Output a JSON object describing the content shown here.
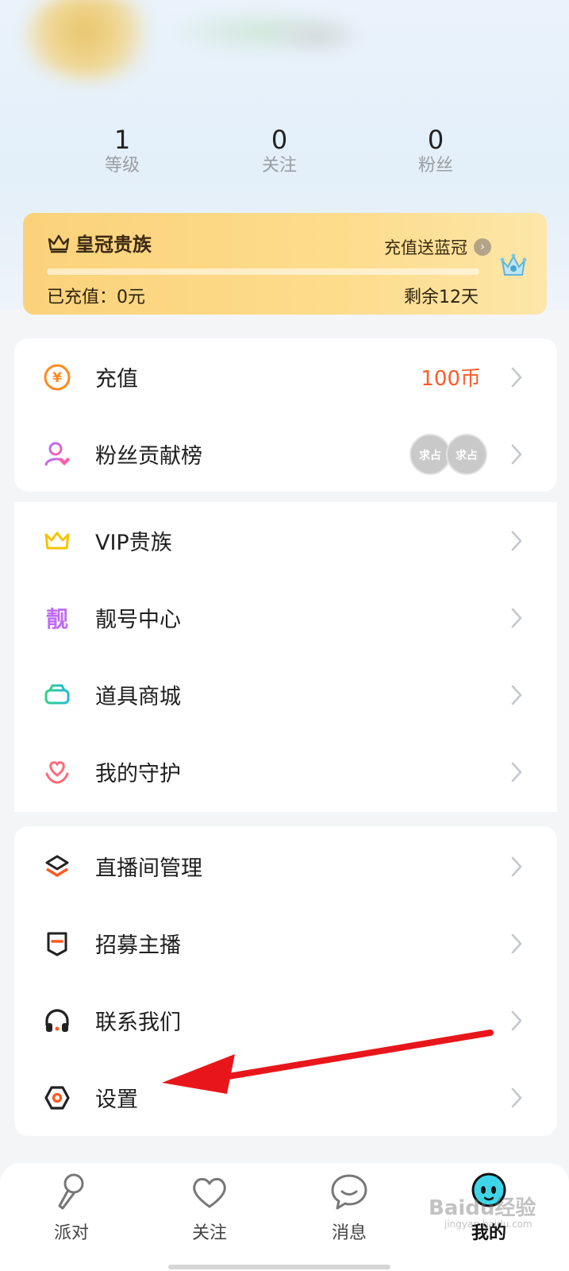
{
  "profile": {
    "stats": [
      {
        "value": "1",
        "label": "等级"
      },
      {
        "value": "0",
        "label": "关注"
      },
      {
        "value": "0",
        "label": "粉丝"
      }
    ]
  },
  "vip_card": {
    "title": "皇冠贵族",
    "promo": "充值送蓝冠",
    "promo_arrow": "›",
    "paid": "已充值：0元",
    "remaining": "剩余12天"
  },
  "menu_group_1": [
    {
      "label": "充值",
      "value": "100币",
      "icon": "yuan-coin-icon"
    },
    {
      "label": "粉丝贡献榜",
      "badges": [
        "求占",
        "求占"
      ],
      "icon": "fan-user-icon"
    }
  ],
  "menu_group_2": [
    {
      "label": "VIP贵族",
      "icon": "crown-icon"
    },
    {
      "label": "靓号中心",
      "icon": "pretty-number-icon",
      "icon_text": "靓"
    },
    {
      "label": "道具商城",
      "icon": "car-icon"
    },
    {
      "label": "我的守护",
      "icon": "guard-heart-icon"
    }
  ],
  "menu_group_3": [
    {
      "label": "直播间管理",
      "icon": "layers-icon"
    },
    {
      "label": "招募主播",
      "icon": "shield-tag-icon"
    },
    {
      "label": "联系我们",
      "icon": "headphones-icon"
    },
    {
      "label": "设置",
      "icon": "hexagon-settings-icon"
    }
  ],
  "tabbar": [
    {
      "label": "派对",
      "icon": "microphone-icon"
    },
    {
      "label": "关注",
      "icon": "heart-icon"
    },
    {
      "label": "消息",
      "icon": "chat-bubble-icon"
    },
    {
      "label": "我的",
      "icon": "mascot-face-icon",
      "active": true
    }
  ],
  "watermark": {
    "main": "Baidu经验",
    "sub": "jingyan.baidu.com"
  },
  "colors": {
    "accent": "#ff5a2b",
    "vip_gold": "#fbd27a",
    "arrow": "#e8161b"
  }
}
